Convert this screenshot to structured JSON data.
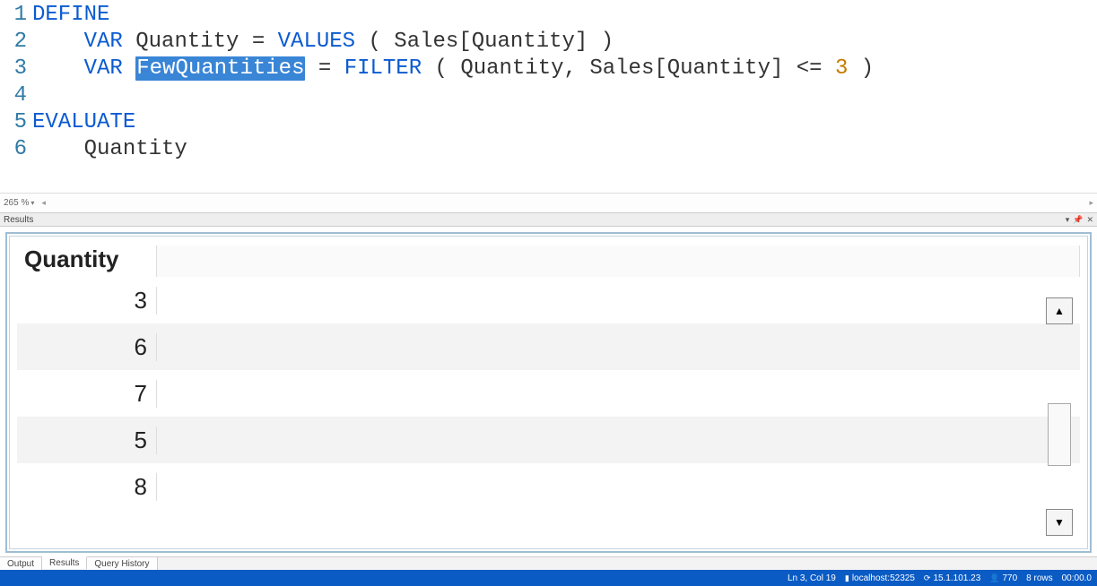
{
  "editor": {
    "zoom": "265 %",
    "lines": [
      {
        "num": "1",
        "tokens": [
          {
            "t": "DEFINE",
            "c": "kw"
          }
        ]
      },
      {
        "num": "2",
        "tokens": [
          {
            "t": "    ",
            "c": "txt"
          },
          {
            "t": "VAR",
            "c": "kw"
          },
          {
            "t": " Quantity = ",
            "c": "txt"
          },
          {
            "t": "VALUES",
            "c": "fn"
          },
          {
            "t": " ( Sales[Quantity] )",
            "c": "txt"
          }
        ]
      },
      {
        "num": "3",
        "tokens": [
          {
            "t": "    ",
            "c": "txt"
          },
          {
            "t": "VAR",
            "c": "kw"
          },
          {
            "t": " ",
            "c": "txt"
          },
          {
            "t": "FewQuantities",
            "c": "sel"
          },
          {
            "t": " = ",
            "c": "txt"
          },
          {
            "t": "FILTER",
            "c": "fn"
          },
          {
            "t": " ( Quantity, Sales[Quantity] <= ",
            "c": "txt"
          },
          {
            "t": "3",
            "c": "num"
          },
          {
            "t": " )",
            "c": "txt"
          }
        ]
      },
      {
        "num": "4",
        "tokens": []
      },
      {
        "num": "5",
        "tokens": [
          {
            "t": "EVALUATE",
            "c": "kw"
          },
          {
            "t": "",
            "c": "cursor"
          }
        ]
      },
      {
        "num": "6",
        "tokens": [
          {
            "t": "    Quantity",
            "c": "txt"
          }
        ]
      }
    ]
  },
  "results_header": "Results",
  "grid": {
    "column_header": "Quantity",
    "rows": [
      "3",
      "6",
      "7",
      "5",
      "8"
    ]
  },
  "tabs": {
    "output": "Output",
    "results": "Results",
    "history": "Query History"
  },
  "status": {
    "pos": "Ln 3, Col 19",
    "server": "localhost:52325",
    "version": "15.1.101.23",
    "spid": "770",
    "rows": "8 rows",
    "time": "00:00.0"
  }
}
